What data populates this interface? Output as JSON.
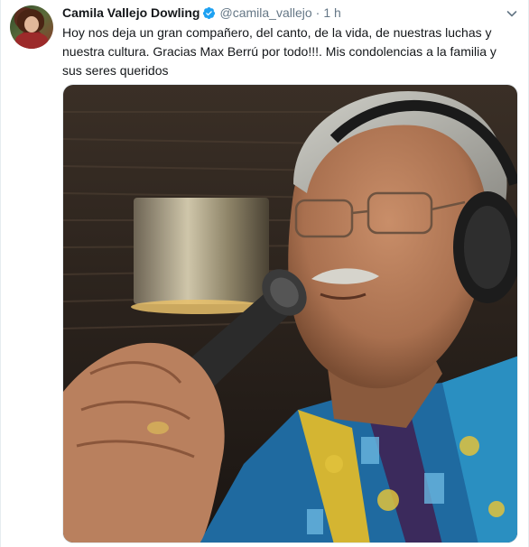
{
  "tweet": {
    "display_name": "Camila Vallejo Dowling",
    "handle": "@camila_vallejo",
    "separator": "·",
    "time": "1 h",
    "text": "Hoy nos deja un gran compañero, del canto, de la vida, de nuestras luchas y nuestra cultura. Gracias Max Berrú por todo!!!. Mis condolencias a la familia y sus seres queridos"
  },
  "icons": {
    "verified": "verified-badge-icon",
    "more": "chevron-down-icon"
  },
  "colors": {
    "name": "#14171a",
    "secondary": "#657786",
    "verified": "#1da1f2",
    "border": "#e6ecf0"
  }
}
